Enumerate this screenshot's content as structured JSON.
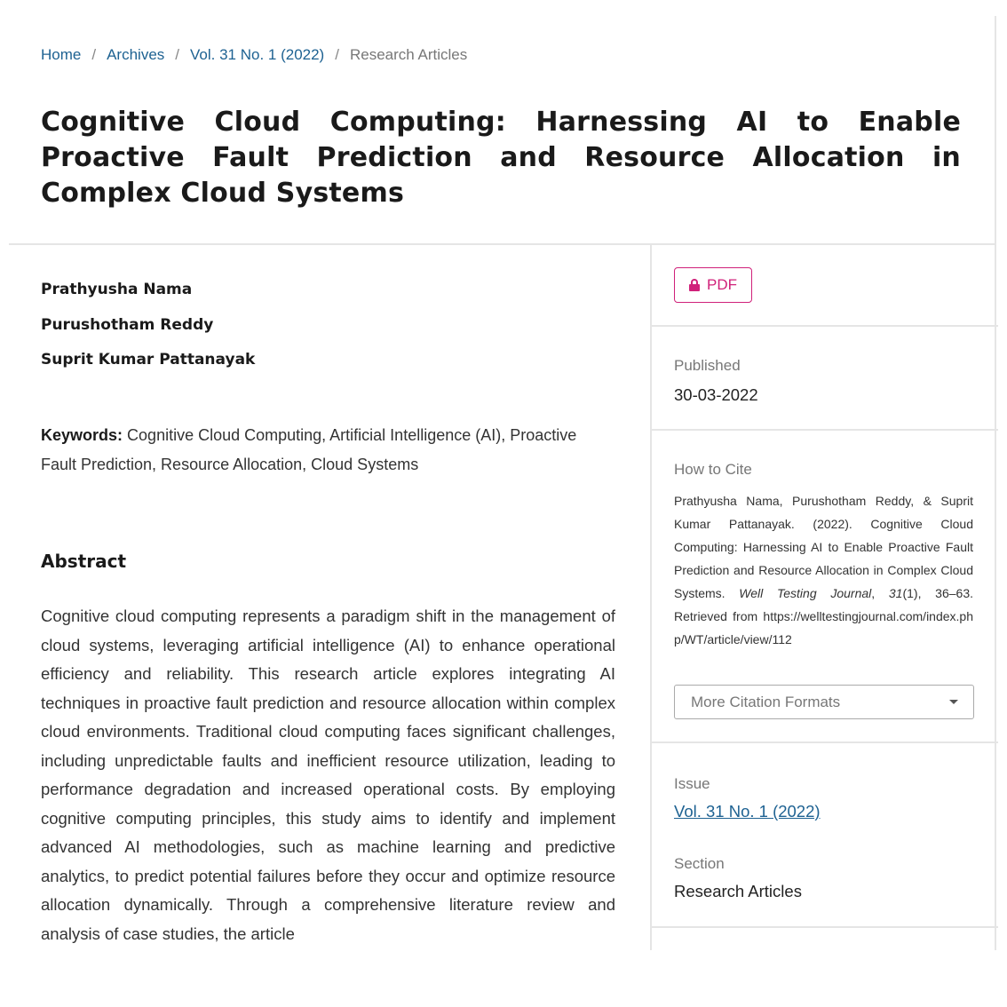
{
  "breadcrumb": {
    "items": [
      {
        "label": "Home",
        "link": true
      },
      {
        "label": "Archives",
        "link": true
      },
      {
        "label": "Vol. 31 No. 1 (2022)",
        "link": true
      },
      {
        "label": "Research Articles",
        "link": false
      }
    ],
    "separator": "/"
  },
  "article": {
    "title": "Cognitive Cloud Computing: Harnessing AI to Enable Proactive Fault Prediction and Resource Allocation in Complex Cloud Systems",
    "authors": [
      "Prathyusha Nama",
      "Purushotham Reddy",
      "Suprit Kumar Pattanayak"
    ],
    "keywords_label": "Keywords:",
    "keywords": "Cognitive Cloud Computing, Artificial Intelligence (AI), Proactive Fault Prediction, Resource Allocation, Cloud Systems",
    "abstract_heading": "Abstract",
    "abstract": "Cognitive cloud computing represents a paradigm shift in the management of cloud systems, leveraging artificial intelligence (AI) to enhance operational efficiency and reliability. This research article explores integrating AI techniques in proactive fault prediction and resource allocation within complex cloud environments. Traditional cloud computing faces significant challenges, including unpredictable faults and inefficient resource utilization, leading to performance degradation and increased operational costs. By employing cognitive computing principles, this study aims to identify and implement advanced AI methodologies, such as machine learning and predictive analytics, to predict potential failures before they occur and optimize resource allocation dynamically. Through a comprehensive literature review and analysis of case studies, the article"
  },
  "sidebar": {
    "pdf_button": {
      "label": "PDF",
      "icon": "lock-icon"
    },
    "published": {
      "label": "Published",
      "value": "30-03-2022"
    },
    "how_to_cite": {
      "label": "How to Cite",
      "authors_year": "Prathyusha Nama, Purushotham Reddy, & Suprit Kumar Pattanayak. (2022). Cognitive Cloud Computing: Harnessing AI to Enable Proactive Fault Prediction and Resource Allocation in Complex Cloud Systems. ",
      "journal": "Well Testing Journal",
      "volume": "31",
      "issue_pages": "(1), 36–63. Retrieved from ",
      "url": "https://welltestingjournal.com/index.php/WT/article/view/112",
      "more_formats_label": "More Citation Formats"
    },
    "issue": {
      "label": "Issue",
      "value": "Vol. 31 No. 1 (2022)"
    },
    "section": {
      "label": "Section",
      "value": "Research Articles"
    }
  },
  "colors": {
    "link": "#1e6292",
    "pdf_accent": "#d0217a",
    "muted_label": "#777777",
    "divider": "#e5e5e5"
  }
}
